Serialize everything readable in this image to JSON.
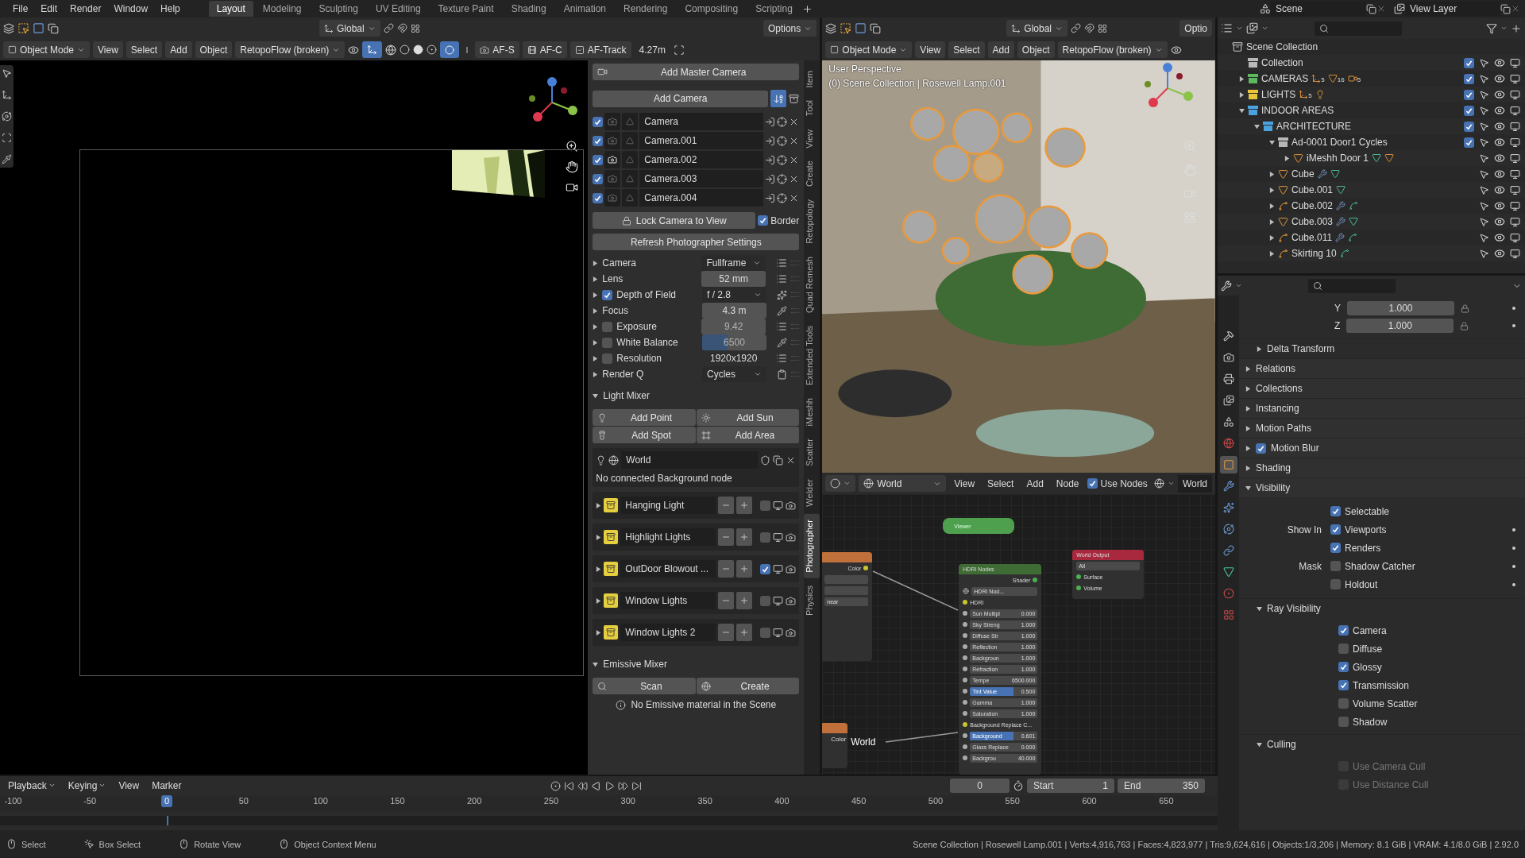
{
  "topbar": {
    "menus": [
      "File",
      "Edit",
      "Render",
      "Window",
      "Help"
    ],
    "workspaces": [
      {
        "label": "Layout",
        "selected": true
      },
      {
        "label": "Modeling",
        "selected": false
      },
      {
        "label": "Sculpting",
        "selected": false
      },
      {
        "label": "UV Editing",
        "selected": false
      },
      {
        "label": "Texture Paint",
        "selected": false
      },
      {
        "label": "Shading",
        "selected": false
      },
      {
        "label": "Animation",
        "selected": false
      },
      {
        "label": "Rendering",
        "selected": false
      },
      {
        "label": "Compositing",
        "selected": false
      },
      {
        "label": "Scripting",
        "selected": false
      }
    ],
    "scene": "Scene",
    "view_layer": "View Layer"
  },
  "left_view": {
    "orientation": "Global",
    "options": "Options",
    "mode": "Object Mode",
    "menus": [
      "View",
      "Select",
      "Add",
      "Object"
    ],
    "addon": "RetopoFlow (broken)",
    "af": [
      {
        "kind": "single",
        "label": "AF-S"
      },
      {
        "kind": "continuous",
        "label": "AF-C"
      },
      {
        "kind": "track",
        "label": "AF-Track"
      }
    ],
    "distance": "4.27m"
  },
  "npanel": {
    "add_master": "Add Master Camera",
    "add_camera": "Add Camera",
    "cameras": [
      {
        "name": "Camera",
        "enabled": true,
        "active": false
      },
      {
        "name": "Camera.001",
        "enabled": true,
        "active": false
      },
      {
        "name": "Camera.002",
        "enabled": true,
        "active": true
      },
      {
        "name": "Camera.003",
        "enabled": true,
        "active": false
      },
      {
        "name": "Camera.004",
        "enabled": true,
        "active": false
      }
    ],
    "lock": "Lock Camera to View",
    "border": {
      "label": "Border",
      "checked": true
    },
    "refresh": "Refresh Photographer Settings",
    "settings": [
      {
        "label": "Camera",
        "kind": "dropdown",
        "value": "Fullframe",
        "disabled": false,
        "tool": {
          "kind": "list"
        }
      },
      {
        "label": "Lens",
        "kind": "number",
        "value": "52 mm",
        "disabled": false,
        "tool": {
          "kind": "list"
        }
      },
      {
        "label": "Depth of Field",
        "checked": true,
        "kind": "dropdown",
        "value": "f / 2.8",
        "disabled": false,
        "tool": {
          "kind": "gear"
        }
      },
      {
        "label": "Focus",
        "kind": "number",
        "value": "4.3 m",
        "disabled": false,
        "tool": {
          "kind": "picker"
        }
      },
      {
        "label": "Exposure",
        "checked": false,
        "kind": "number",
        "value": "9.42",
        "disabled": true,
        "tool": {
          "kind": "list"
        }
      },
      {
        "label": "White Balance",
        "checked": false,
        "kind": "slider",
        "value": "6500",
        "level": 0.4,
        "disabled": true,
        "tool": {
          "kind": "picker"
        }
      },
      {
        "label": "Resolution",
        "checked": false,
        "kind": "text",
        "value": "1920x1920",
        "disabled": false,
        "tool": {
          "kind": "list"
        }
      },
      {
        "label": "Render Q",
        "kind": "dropdown",
        "value": "Cycles",
        "disabled": false,
        "tool": {
          "kind": "clipboard"
        }
      }
    ],
    "light_mixer": {
      "title": "Light Mixer",
      "expanded": true,
      "buttons": [
        {
          "kind": "point",
          "label": "Add Point"
        },
        {
          "kind": "sun",
          "label": "Add Sun"
        },
        {
          "kind": "spot",
          "label": "Add Spot"
        },
        {
          "kind": "area",
          "label": "Add Area"
        }
      ],
      "world": "World",
      "note": "No connected Background node",
      "groups": [
        {
          "name": "Hanging Light",
          "checked": false
        },
        {
          "name": "Highlight Lights",
          "checked": false
        },
        {
          "name": "OutDoor Blowout ...",
          "checked": true
        },
        {
          "name": "Window Lights",
          "checked": false
        },
        {
          "name": "Window Lights 2",
          "checked": false
        }
      ]
    },
    "emissive": {
      "title": "Emissive Mixer",
      "expanded": true,
      "scan": "Scan",
      "create": "Create",
      "note": "No Emissive material in the Scene"
    },
    "tabs": [
      {
        "label": "Item",
        "selected": false
      },
      {
        "label": "Tool",
        "selected": false
      },
      {
        "label": "View",
        "selected": false
      },
      {
        "label": "Create",
        "selected": false
      },
      {
        "label": "Retopology",
        "selected": false
      },
      {
        "label": "Quad Remesh",
        "selected": false
      },
      {
        "label": "Extended Tools",
        "selected": false
      },
      {
        "label": "iMeshh",
        "selected": false
      },
      {
        "label": "Scatter",
        "selected": false
      },
      {
        "label": "Welder",
        "selected": false
      },
      {
        "label": "Photographer",
        "selected": true
      },
      {
        "label": "Physics",
        "selected": false
      }
    ]
  },
  "right_view": {
    "orientation": "Global",
    "options": "Optio",
    "mode": "Object Mode",
    "menus": [
      "View",
      "Select",
      "Add",
      "Object"
    ],
    "addon": "RetopoFlow (broken)",
    "perspective": "User Perspective",
    "context": "(0) Scene Collection | Rosewell Lamp.001"
  },
  "node_editor": {
    "world": "World",
    "menus": [
      "View",
      "Select",
      "Add",
      "Node"
    ],
    "use_nodes": {
      "label": "Use Nodes",
      "checked": true
    },
    "slot": "World",
    "viewer": "Viewer",
    "image_node": {
      "socket": "Color",
      "option": "near"
    },
    "hdri": {
      "title": "HDRI Nodes",
      "output": "Shader",
      "datablock": "HDRI Nod...",
      "input": "HDRI",
      "params": [
        {
          "label": "Sun Multipl",
          "value": "0.000",
          "selected": false
        },
        {
          "label": "Sky Streng",
          "value": "1.000",
          "selected": false
        },
        {
          "label": "Diffuse Str",
          "value": "1.000",
          "selected": false
        },
        {
          "label": "Reflection",
          "value": "1.000",
          "selected": false
        },
        {
          "label": "Backgroun",
          "value": "1.000",
          "selected": false
        },
        {
          "label": "Refraction",
          "value": "1.000",
          "selected": false
        },
        {
          "label": "Tempe",
          "value": "6500.000",
          "selected": false
        },
        {
          "label": "Tint Value",
          "value": "0.500",
          "selected": true
        },
        {
          "label": "Gamma",
          "value": "1.000",
          "selected": false
        },
        {
          "label": "Saturation",
          "value": "1.000",
          "selected": false
        }
      ],
      "replace": "Background Replace C...",
      "params2": [
        {
          "label": "Background",
          "value": "0.601",
          "selected": true
        },
        {
          "label": "Glass Replace",
          "value": "0.000",
          "selected": false
        },
        {
          "label": "Backgrou",
          "value": "40.000",
          "selected": false
        }
      ]
    },
    "output": {
      "title": "World Output",
      "target": "All",
      "sockets": [
        "Surface",
        "Volume"
      ]
    },
    "color_node": {
      "socket": "Color",
      "label": "World"
    }
  },
  "timeline": {
    "menus": [
      "Playback",
      "Keying",
      "View",
      "Marker"
    ],
    "frame": "0",
    "start_label": "Start",
    "start": "1",
    "end_label": "End",
    "end": "350",
    "ruler": [
      {
        "label": "-100",
        "current": false
      },
      {
        "label": "-50",
        "current": false
      },
      {
        "label": "0",
        "current": true
      },
      {
        "label": "50",
        "current": false
      },
      {
        "label": "100",
        "current": false
      },
      {
        "label": "150",
        "current": false
      },
      {
        "label": "200",
        "current": false
      },
      {
        "label": "250",
        "current": false
      },
      {
        "label": "300",
        "current": false
      },
      {
        "label": "350",
        "current": false
      },
      {
        "label": "400",
        "current": false
      },
      {
        "label": "450",
        "current": false
      },
      {
        "label": "500",
        "current": false
      },
      {
        "label": "550",
        "current": false
      },
      {
        "label": "600",
        "current": false
      },
      {
        "label": "650",
        "current": false
      }
    ]
  },
  "outliner": {
    "root": "Scene Collection",
    "items": [
      {
        "name": "Collection",
        "kind": "collection",
        "color": "#b8b8b8",
        "checked": true
      },
      {
        "name": "CAMERAS",
        "kind": "collection",
        "color": "#5cb85c",
        "checked": true,
        "expanded": false,
        "badges": [
          {
            "kind": "empty",
            "count": "5"
          },
          {
            "kind": "mesh",
            "count": "16"
          },
          {
            "kind": "camera",
            "count": "5"
          }
        ]
      },
      {
        "name": "LIGHTS",
        "kind": "collection",
        "color": "#e8c53a",
        "checked": true,
        "expanded": false,
        "badges": [
          {
            "kind": "empty",
            "count": "5"
          },
          {
            "kind": "light"
          }
        ]
      },
      {
        "name": "INDOOR AREAS",
        "kind": "collection",
        "color": "#4aa3df",
        "checked": true,
        "expanded": true,
        "children": [
          {
            "name": "ARCHITECTURE",
            "kind": "collection",
            "color": "#4aa3df",
            "checked": true,
            "expanded": true,
            "children": [
              {
                "name": "Ad-0001 Door1 Cycles",
                "kind": "collection",
                "color": "#b8b8b8",
                "checked": true,
                "expanded": true,
                "children": [
                  {
                    "name": "iMeshh Door 1",
                    "kind": "mesh",
                    "expanded": false,
                    "badges": [
                      {
                        "kind": "mesh-data"
                      },
                      {
                        "kind": "mesh"
                      }
                    ]
                  }
                ]
              },
              {
                "name": "Cube",
                "kind": "mesh",
                "expanded": false,
                "badges": [
                  {
                    "kind": "modifier"
                  },
                  {
                    "kind": "mesh-data"
                  }
                ]
              },
              {
                "name": "Cube.001",
                "kind": "mesh",
                "expanded": false,
                "badges": [
                  {
                    "kind": "mesh-data"
                  }
                ]
              },
              {
                "name": "Cube.002",
                "kind": "curve",
                "expanded": false,
                "badges": [
                  {
                    "kind": "modifier"
                  },
                  {
                    "kind": "curve-data"
                  }
                ]
              },
              {
                "name": "Cube.003",
                "kind": "mesh",
                "expanded": false,
                "badges": [
                  {
                    "kind": "modifier"
                  },
                  {
                    "kind": "mesh-data"
                  }
                ]
              },
              {
                "name": "Cube.011",
                "kind": "curve",
                "expanded": false,
                "badges": [
                  {
                    "kind": "modifier"
                  },
                  {
                    "kind": "curve-data"
                  }
                ]
              },
              {
                "name": "Skirting 10",
                "kind": "curve",
                "expanded": false,
                "badges": [
                  {
                    "kind": "curve-data"
                  }
                ]
              }
            ]
          }
        ]
      }
    ]
  },
  "properties": {
    "tabs": [
      {
        "kind": "tool",
        "selected": false
      },
      {
        "kind": "render",
        "selected": false
      },
      {
        "kind": "output",
        "selected": false
      },
      {
        "kind": "view-layer",
        "selected": false
      },
      {
        "kind": "scene",
        "selected": false
      },
      {
        "kind": "world",
        "selected": false
      },
      {
        "kind": "object",
        "selected": true
      },
      {
        "kind": "modifier",
        "selected": false
      },
      {
        "kind": "particles",
        "selected": false
      },
      {
        "kind": "physics",
        "selected": false
      },
      {
        "kind": "constraints",
        "selected": false
      },
      {
        "kind": "data",
        "selected": false
      },
      {
        "kind": "material",
        "selected": false
      },
      {
        "kind": "texture",
        "selected": false
      }
    ],
    "scale": [
      {
        "label": "Y",
        "value": "1.000"
      },
      {
        "label": "Z",
        "value": "1.000"
      }
    ],
    "panels": [
      {
        "title": "Delta Transform",
        "expanded": false,
        "kind": "sub"
      },
      {
        "title": "Relations",
        "expanded": false,
        "kind": "main"
      },
      {
        "title": "Collections",
        "expanded": false,
        "kind": "main"
      },
      {
        "title": "Instancing",
        "expanded": false,
        "kind": "main"
      },
      {
        "title": "Motion Paths",
        "expanded": false,
        "kind": "main"
      },
      {
        "title": "Motion Blur",
        "expanded": false,
        "kind": "main",
        "checked": true
      },
      {
        "title": "Shading",
        "expanded": false,
        "kind": "main"
      },
      {
        "title": "Visibility",
        "expanded": true,
        "kind": "main"
      }
    ],
    "visibility": [
      {
        "label": "Selectable",
        "checked": true
      },
      {
        "group": "Show In",
        "label": "Viewports",
        "checked": true
      },
      {
        "label": "Renders",
        "checked": true
      },
      {
        "group": "Mask",
        "label": "Shadow Catcher",
        "checked": false
      },
      {
        "label": "Holdout",
        "checked": false
      }
    ],
    "ray": {
      "title": "Ray Visibility",
      "expanded": true,
      "items": [
        {
          "label": "Camera",
          "checked": true
        },
        {
          "label": "Diffuse",
          "checked": false
        },
        {
          "label": "Glossy",
          "checked": true
        },
        {
          "label": "Transmission",
          "checked": true
        },
        {
          "label": "Volume Scatter",
          "checked": false
        },
        {
          "label": "Shadow",
          "checked": false
        }
      ]
    },
    "culling": {
      "title": "Culling",
      "expanded": true,
      "items": [
        {
          "label": "Use Camera Cull",
          "checked": false,
          "disabled": true
        },
        {
          "label": "Use Distance Cull",
          "checked": false,
          "disabled": true
        }
      ]
    }
  },
  "status": {
    "items": [
      {
        "kind": "left",
        "label": "Select"
      },
      {
        "kind": "box",
        "label": "Box Select"
      },
      {
        "kind": "middle",
        "label": "Rotate View"
      },
      {
        "kind": "right",
        "label": "Object Context Menu"
      }
    ],
    "stats": "Scene Collection | Rosewell Lamp.001 | Verts:4,916,763 | Faces:4,823,977 | Tris:9,624,616 | Objects:1/3,206 | Memory: 8.1 GiB | VRAM: 4.1/8.0 GiB | 2.92.0"
  }
}
